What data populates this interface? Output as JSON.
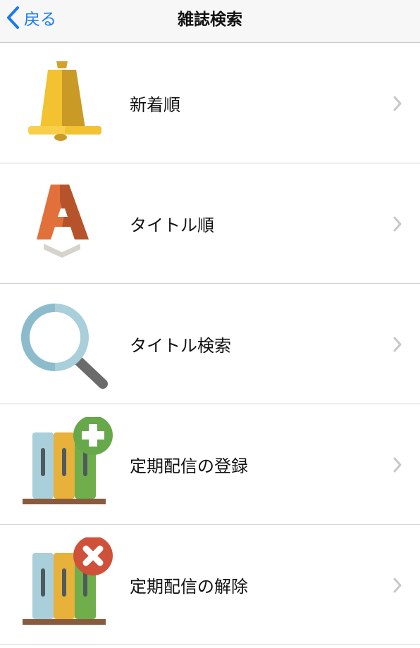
{
  "navbar": {
    "back_label": "戻る",
    "title": "雑誌検索"
  },
  "menu": {
    "items": [
      {
        "label": "新着順",
        "icon": "bell-icon"
      },
      {
        "label": "タイトル順",
        "icon": "letter-a-sort-icon"
      },
      {
        "label": "タイトル検索",
        "icon": "magnifier-icon"
      },
      {
        "label": "定期配信の登録",
        "icon": "books-add-icon"
      },
      {
        "label": "定期配信の解除",
        "icon": "books-remove-icon"
      }
    ]
  },
  "colors": {
    "accent": "#1a7af0",
    "bell": "#f2c230",
    "letter_a": "#e2703a",
    "magnifier": "#a9cfdb",
    "add_badge": "#66a84a",
    "remove_badge": "#cf5139"
  }
}
